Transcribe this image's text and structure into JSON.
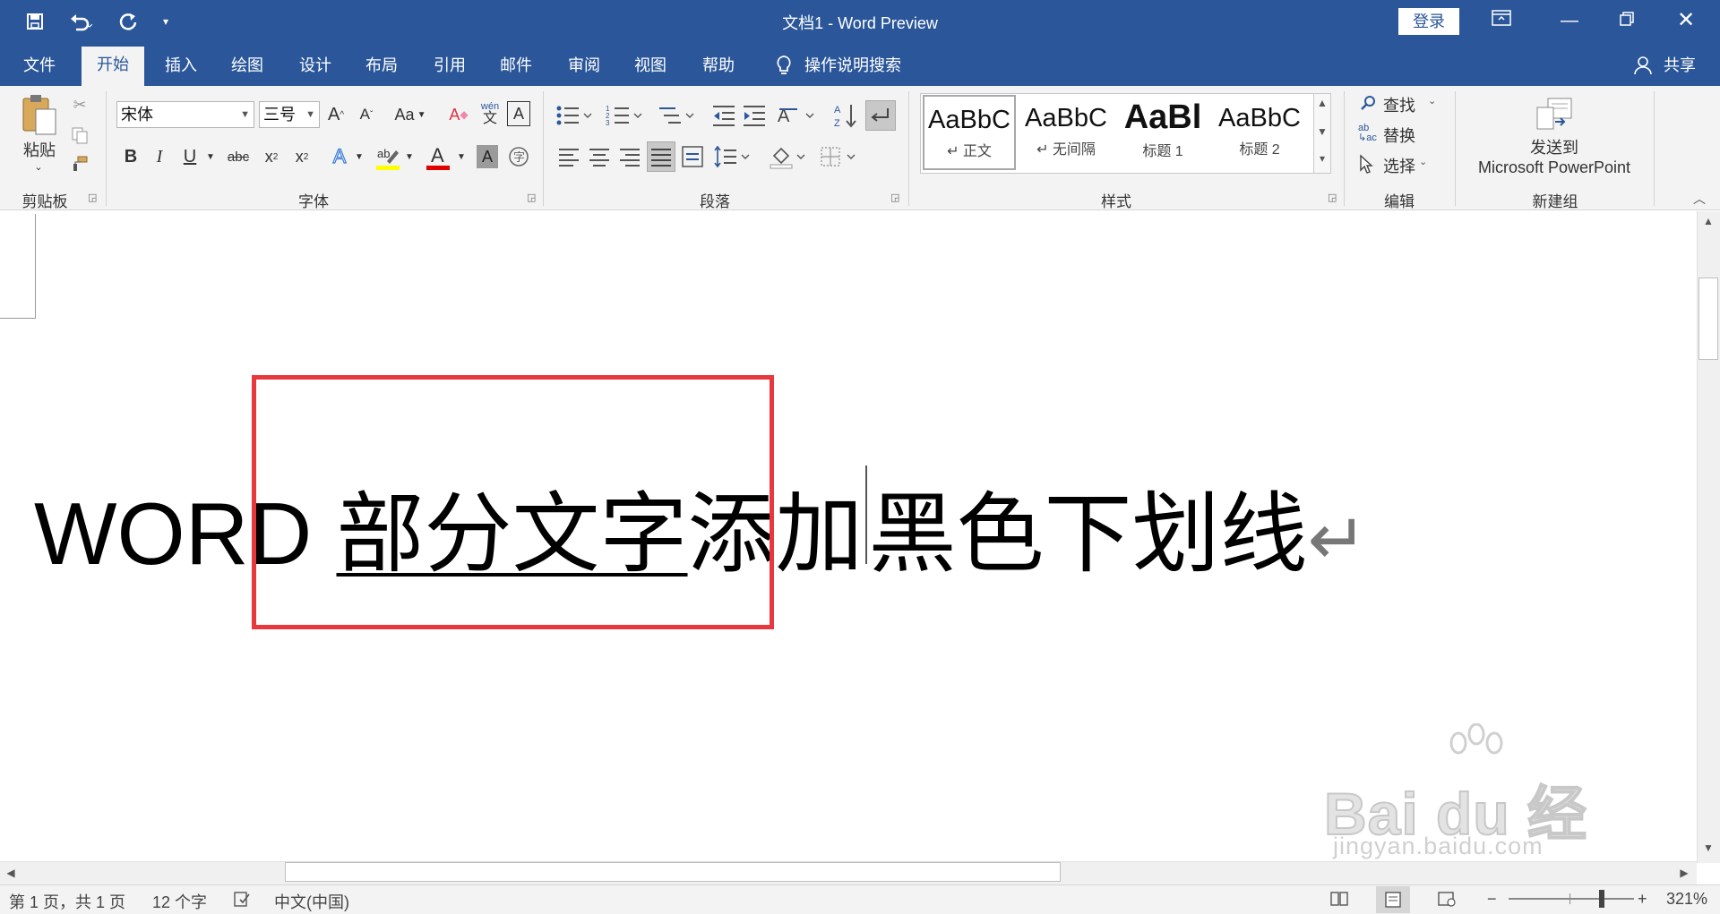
{
  "titlebar": {
    "title": "文档1  -  Word Preview",
    "login": "登录",
    "quick_access": [
      "save-icon",
      "undo-icon",
      "redo-icon",
      "customize-icon"
    ],
    "window_buttons": [
      "ribbon-display-icon",
      "minimize-icon",
      "restore-icon",
      "close-icon"
    ],
    "color": "#2b579a"
  },
  "tabs": {
    "items": [
      "文件",
      "开始",
      "插入",
      "绘图",
      "设计",
      "布局",
      "引用",
      "邮件",
      "审阅",
      "视图",
      "帮助"
    ],
    "search": "操作说明搜索",
    "share": "共享",
    "active": "开始"
  },
  "ribbon": {
    "clipboard": {
      "paste": "粘贴",
      "label": "剪贴板"
    },
    "font": {
      "name": "宋体",
      "size": "三号",
      "label": "字体",
      "case": "Aa",
      "pinyin_top": "wén",
      "pinyin_bottom": "文"
    },
    "paragraph": {
      "label": "段落"
    },
    "styles": {
      "label": "样式",
      "items": [
        {
          "sample": "AaBbC",
          "name": "↵ 正文"
        },
        {
          "sample": "AaBbC",
          "name": "↵ 无间隔"
        },
        {
          "sample": "AaBl",
          "name": "标题 1"
        },
        {
          "sample": "AaBbC",
          "name": "标题 2"
        }
      ]
    },
    "editing": {
      "find": "查找",
      "replace": "替换",
      "select": "选择",
      "label": "编辑"
    },
    "newgroup": {
      "line1": "发送到",
      "line2": "Microsoft PowerPoint",
      "label": "新建组"
    }
  },
  "document": {
    "text_before": "WORD ",
    "text_underlined": "部分文字",
    "text_mid": "添加",
    "text_after": "黑色下划线",
    "para_mark": "↵",
    "highlight_color": "#e8383d"
  },
  "statusbar": {
    "page": "第 1 页，共 1 页",
    "words": "12 个字",
    "language": "中文(中国)",
    "zoom": "321%",
    "zoom_minus": "−",
    "zoom_plus": "+"
  },
  "watermark": {
    "brand": "Bai du 经验",
    "url": "jingyan.baidu.com"
  }
}
